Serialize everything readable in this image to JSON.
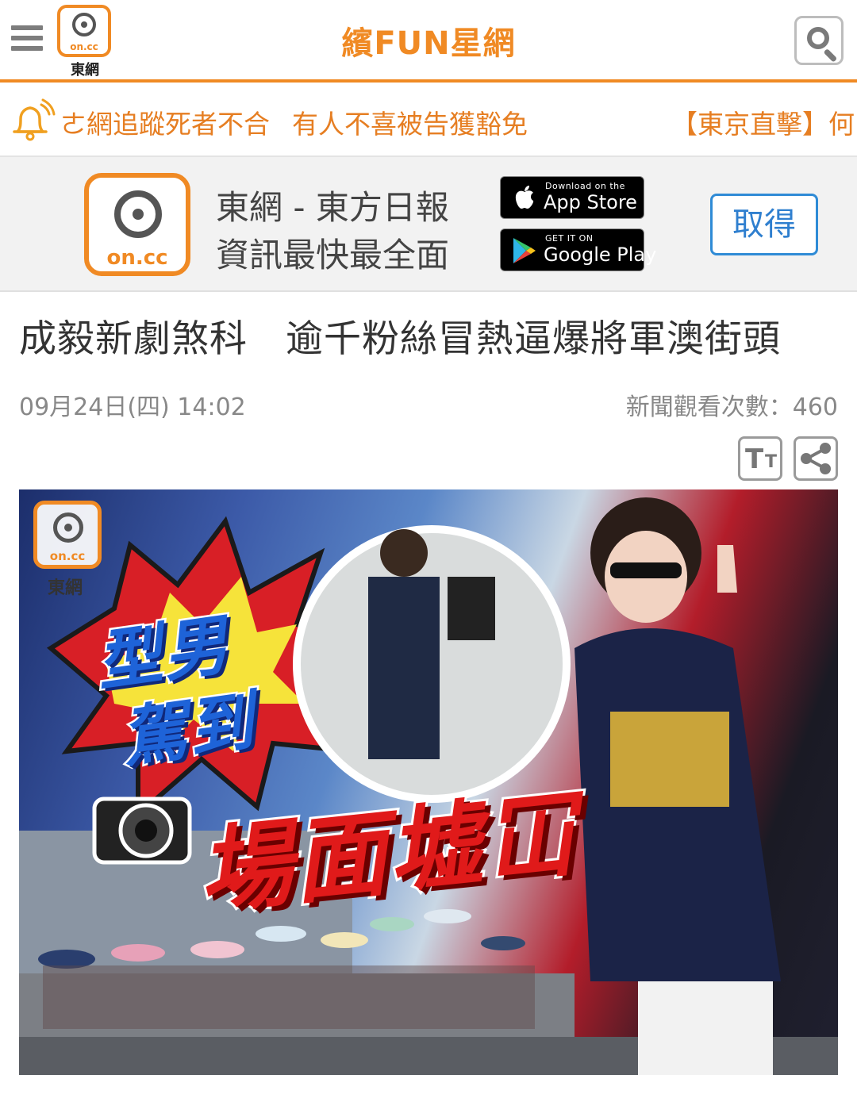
{
  "header": {
    "logo_text": "on.cc",
    "logo_caption": "東網",
    "site_title": "繽FUN星網"
  },
  "ticker": {
    "items": [
      "ㄜ網追蹤死者不合",
      "有人不喜被告獲豁免",
      "【東京直擊】何"
    ]
  },
  "app_banner": {
    "logo_text": "on.cc",
    "line1": "東網 - 東方日報",
    "line2": "資訊最快最全面",
    "appstore_small": "Download on the",
    "appstore_big": "App Store",
    "googleplay_small": "GET IT ON",
    "googleplay_big": "Google Play",
    "get_button": "取得"
  },
  "article": {
    "headline": "成毅新劇煞科　逾千粉絲冒熱逼爆將軍澳街頭",
    "date": "09月24日(四) 14:02",
    "views_label": "新聞觀看次數：460",
    "font_button_big": "T",
    "font_button_small": "T"
  },
  "hero_image": {
    "logo_text": "on.cc",
    "logo_caption": "東網",
    "blue_text_1": "型男",
    "blue_text_2": "駕到",
    "red_text": "場面墟冚"
  },
  "colors": {
    "brand_orange": "#f08a24",
    "ticker_text": "#e67e22",
    "link_blue": "#2f7fcf"
  }
}
